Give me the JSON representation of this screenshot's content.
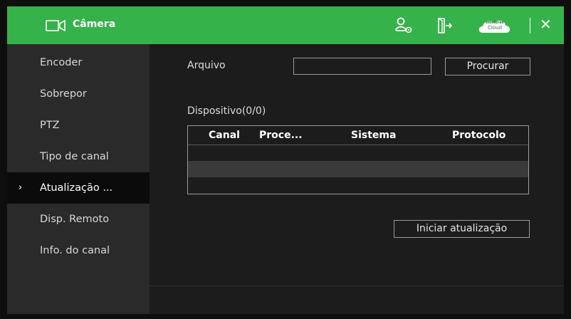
{
  "header": {
    "title": "Câmera",
    "icons": [
      "camera-icon",
      "user-settings-icon",
      "exit-icon",
      "cloud-icon",
      "close-icon"
    ],
    "cloud_badge": {
      "line1": "intelbras",
      "line2": "Cloud"
    },
    "close_symbol": "✕",
    "accent_color": "#35b24a"
  },
  "sidebar": {
    "items": [
      {
        "label": "Encoder"
      },
      {
        "label": "Sobrepor"
      },
      {
        "label": "PTZ"
      },
      {
        "label": "Tipo de canal"
      },
      {
        "label": "Atualização ...",
        "active": true,
        "marker": "›"
      },
      {
        "label": "Disp. Remoto"
      },
      {
        "label": "Info. do canal"
      }
    ]
  },
  "main": {
    "file_label": "Arquivo",
    "file_value": "",
    "browse_label": "Procurar",
    "device_label": "Dispositivo(0/0)",
    "table": {
      "columns": [
        "Canal",
        "Proce...",
        "Sistema",
        "Protocolo"
      ],
      "rows": []
    },
    "upgrade_label": "Iniciar atualização"
  }
}
